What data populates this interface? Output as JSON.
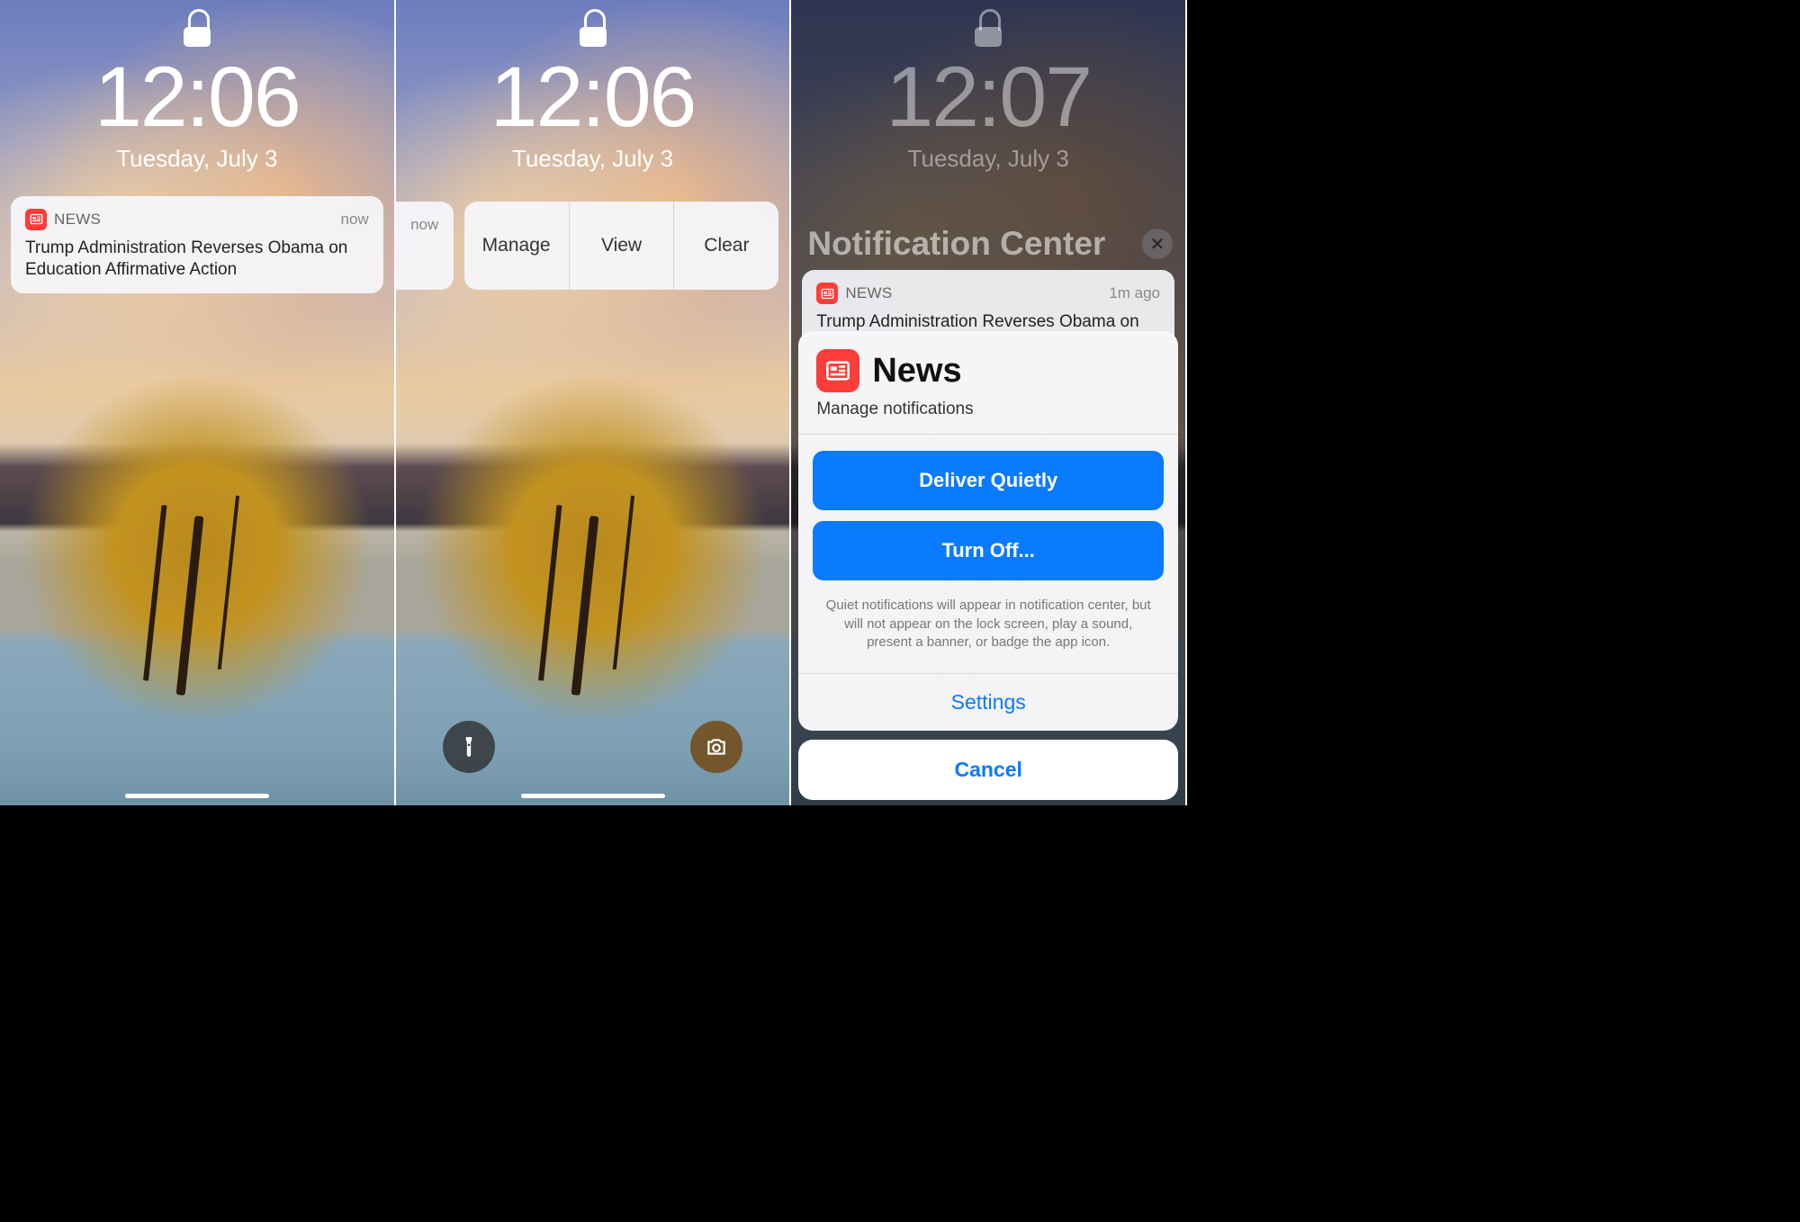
{
  "screen1": {
    "time": "12:06",
    "date": "Tuesday, July 3",
    "notification": {
      "app": "NEWS",
      "when": "now",
      "body": "Trump Administration Reverses Obama on Education Affirmative Action"
    }
  },
  "screen2": {
    "time": "12:06",
    "date": "Tuesday, July 3",
    "sliver_when": "now",
    "actions": {
      "manage": "Manage",
      "view": "View",
      "clear": "Clear"
    }
  },
  "screen3": {
    "time": "12:07",
    "date": "Tuesday, July 3",
    "nc_title": "Notification Center",
    "notification": {
      "app": "NEWS",
      "when": "1m ago",
      "body_truncated": "Trump Administration Reverses Obama on"
    },
    "sheet": {
      "app_name": "News",
      "subtitle": "Manage notifications",
      "deliver_quietly": "Deliver Quietly",
      "turn_off": "Turn Off...",
      "description": "Quiet notifications will appear in notification center, but will not appear on the lock screen, play a sound, present a banner, or badge the app icon.",
      "settings": "Settings",
      "cancel": "Cancel"
    }
  }
}
